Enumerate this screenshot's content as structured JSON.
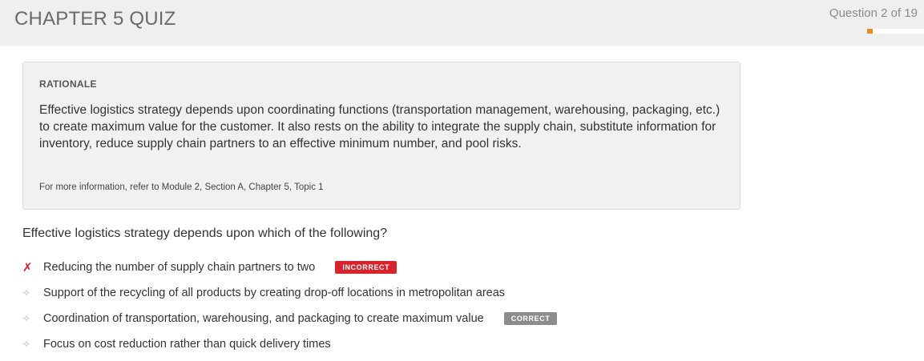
{
  "header": {
    "title": "CHAPTER 5 QUIZ",
    "counter": "Question 2 of 19",
    "progress_fraction": 0.105,
    "accent_color": "#f0881d"
  },
  "rationale": {
    "heading": "RATIONALE",
    "text": "Effective logistics strategy depends upon coordinating functions (transportation management, warehousing, packaging, etc.) to create maximum value for the customer. It also rests on the ability to integrate the supply chain, substitute information for inventory, reduce supply chain partners to an effective minimum number, and pool risks.",
    "reference": "For more information, refer to Module 2, Section A, Chapter 5, Topic 1"
  },
  "question": {
    "text": "Effective logistics strategy depends upon which of the following?"
  },
  "answers": [
    {
      "label": "Reducing the number of supply chain partners to two",
      "marker": "✗",
      "marker_type": "wrong",
      "badge": "INCORRECT"
    },
    {
      "label": "Support of the recycling of all products by creating drop-off locations in metropolitan areas",
      "marker": "✧",
      "marker_type": "neutral",
      "badge": ""
    },
    {
      "label": "Coordination of transportation, warehousing, and packaging to create maximum value",
      "marker": "✧",
      "marker_type": "neutral",
      "badge": "CORRECT"
    },
    {
      "label": "Focus on cost reduction rather than quick delivery times",
      "marker": "✧",
      "marker_type": "neutral",
      "badge": ""
    }
  ],
  "colors": {
    "incorrect": "#d9232b",
    "correct_badge": "#8c8c8c"
  }
}
